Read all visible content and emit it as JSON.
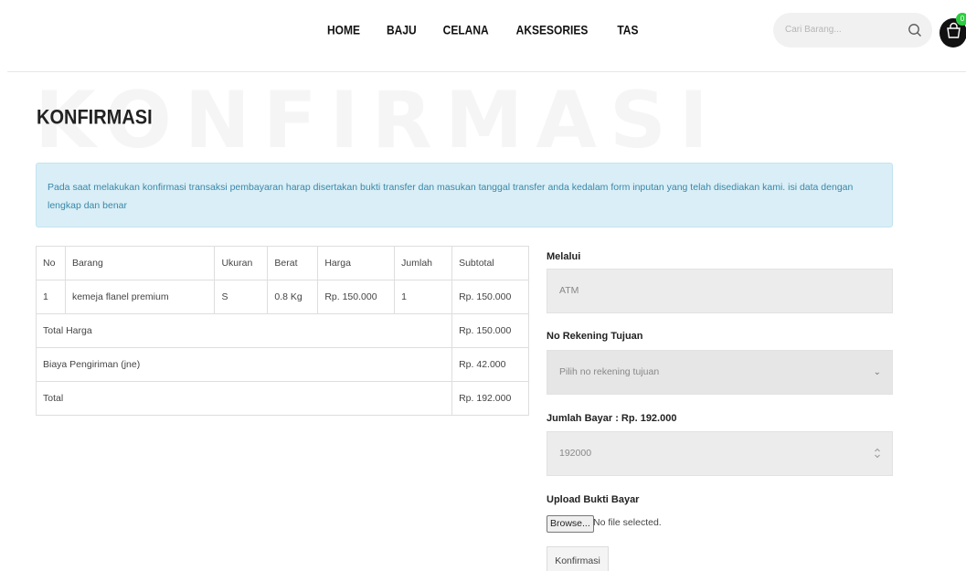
{
  "nav": {
    "menu": [
      "HOME",
      "BAJU",
      "CELANA",
      "AKSESORIES",
      "TAS"
    ],
    "search_placeholder": "Cari Barang...",
    "cart_count": "0"
  },
  "page": {
    "background_word": "KONFIRMASI",
    "title": "KONFIRMASI",
    "alert": "Pada saat melakukan konfirmasi transaksi pembayaran harap disertakan bukti transfer dan masukan tanggal transfer anda kedalam form inputan yang telah disediakan kami. isi data dengan lengkap dan benar"
  },
  "table": {
    "headers": [
      "No",
      "Barang",
      "Ukuran",
      "Berat",
      "Harga",
      "Jumlah",
      "Subtotal"
    ],
    "rows": [
      [
        "1",
        "kemeja flanel premium",
        "S",
        "0.8 Kg",
        "Rp. 150.000",
        "1",
        "Rp. 150.000"
      ]
    ],
    "summary": [
      {
        "label": "Total Harga",
        "value": "Rp. 150.000"
      },
      {
        "label": "Biaya Pengiriman (jne)",
        "value": "Rp. 42.000"
      },
      {
        "label": "Total",
        "value": "Rp. 192.000"
      }
    ]
  },
  "form": {
    "melalui_label": "Melalui",
    "melalui_value": "ATM",
    "rekening_label": "No Rekening Tujuan",
    "rekening_value": "Pilih no rekening tujuan",
    "jumlah_label": "Jumlah Bayar : Rp. 192.000",
    "jumlah_value": "192000",
    "upload_label": "Upload Bukti Bayar",
    "browse_label": "Browse...",
    "file_status": "No file selected.",
    "submit_label": "Konfirmasi"
  },
  "colors": {
    "alert_bg": "#d9eef6",
    "alert_text": "#3a87a8",
    "badge": "#2ecc40"
  }
}
